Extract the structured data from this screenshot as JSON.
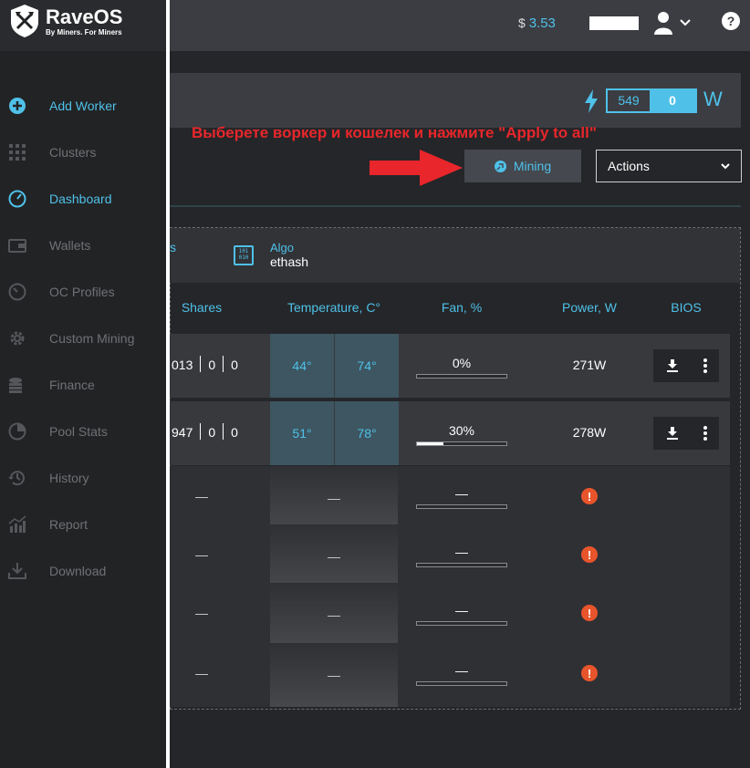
{
  "brand": {
    "name": "RaveOS",
    "tagline": "By Miners. For Miners"
  },
  "sidebar": {
    "items": [
      {
        "label": "Add Worker",
        "icon": "plus-circle-icon",
        "active": true
      },
      {
        "label": "Clusters",
        "icon": "grid-icon",
        "active": false
      },
      {
        "label": "Dashboard",
        "icon": "gauge-icon",
        "active": true
      },
      {
        "label": "Wallets",
        "icon": "wallet-icon",
        "active": false
      },
      {
        "label": "OC Profiles",
        "icon": "speedometer-icon",
        "active": false
      },
      {
        "label": "Custom Mining",
        "icon": "gear-icon",
        "active": false
      },
      {
        "label": "Finance",
        "icon": "coins-icon",
        "active": false
      },
      {
        "label": "Pool Stats",
        "icon": "pie-icon",
        "active": false
      },
      {
        "label": "History",
        "icon": "history-icon",
        "active": false
      },
      {
        "label": "Report",
        "icon": "chart-icon",
        "active": false
      },
      {
        "label": "Download",
        "icon": "download-icon",
        "active": false
      }
    ]
  },
  "header": {
    "currency": "$",
    "balance": "3.53"
  },
  "power": {
    "value": "549",
    "delta": "0",
    "unit": "W"
  },
  "annotation": "Выберете воркер и кошелек и нажмите \"Apply to all\"",
  "toolbar": {
    "mining_label": "Mining",
    "actions_label": "Actions"
  },
  "card": {
    "partial_label": "s",
    "algo_icon_text": "101 010",
    "algo_label": "Algo",
    "algo_value": "ethash"
  },
  "table": {
    "headers": [
      "Shares",
      "Temperature, C°",
      "Fan, %",
      "Power, W",
      "BIOS"
    ],
    "empty_value": "—",
    "rows": [
      {
        "shares": [
          "013",
          "0",
          "0"
        ],
        "temps": [
          "44°",
          "74°"
        ],
        "fan_label": "0%",
        "fan_fraction": 0,
        "power": "271W"
      },
      {
        "shares": [
          "947",
          "0",
          "0"
        ],
        "temps": [
          "51°",
          "78°"
        ],
        "fan_label": "30%",
        "fan_fraction": 0.3,
        "power": "278W"
      }
    ],
    "warning_symbol": "!"
  },
  "colors": {
    "accent": "#4fc1e9",
    "warning": "#e8542b",
    "annotation": "#e8262b"
  }
}
